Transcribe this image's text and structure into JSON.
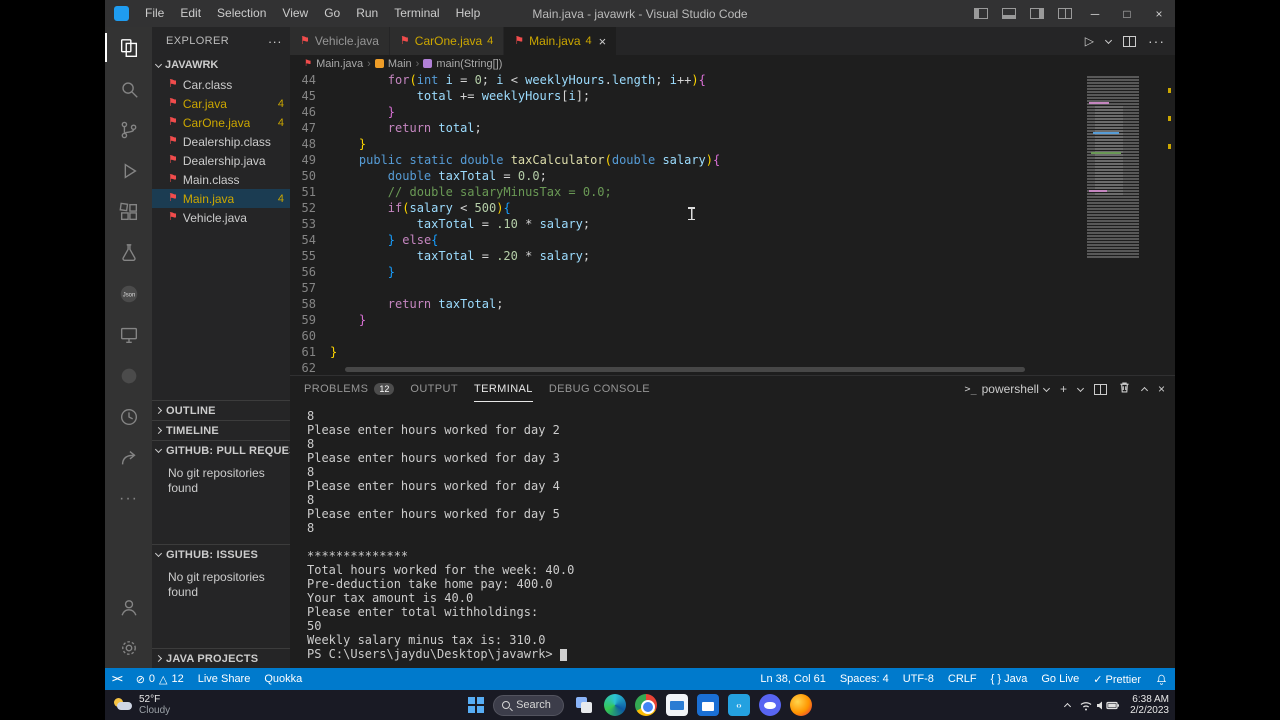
{
  "glyphs": {
    "file": "⚑",
    "close": "×",
    "more": "···",
    "run": "▷",
    "plus": "+",
    "error": "⊘",
    "warning": "△"
  },
  "title_bar": {
    "menus": [
      "File",
      "Edit",
      "Selection",
      "View",
      "Go",
      "Run",
      "Terminal",
      "Help"
    ],
    "title": "Main.java - javawrk - Visual Studio Code",
    "controls": [
      "─",
      "□",
      "×"
    ]
  },
  "activity_bar": {
    "items": [
      "explorer",
      "search",
      "source-control",
      "run-debug",
      "extensions",
      "testing",
      "json",
      "remote-explorer",
      "extension-circle",
      "clock",
      "live-share",
      "more",
      "account",
      "settings"
    ],
    "json_label": "Json",
    "more_label": "···"
  },
  "sidebar": {
    "header": "EXPLORER",
    "header_more": "···",
    "root_label": "JAVAWRK",
    "files": [
      {
        "label": "Car.class",
        "badge": ""
      },
      {
        "label": "Car.java",
        "badge": "4"
      },
      {
        "label": "CarOne.java",
        "badge": "4"
      },
      {
        "label": "Dealership.class",
        "badge": ""
      },
      {
        "label": "Dealership.java",
        "badge": ""
      },
      {
        "label": "Main.class",
        "badge": ""
      },
      {
        "label": "Main.java",
        "badge": "4",
        "selected": true
      },
      {
        "label": "Vehicle.java",
        "badge": ""
      }
    ],
    "sections": [
      {
        "label": "OUTLINE",
        "expanded": false,
        "body": ""
      },
      {
        "label": "TIMELINE",
        "expanded": false,
        "body": ""
      },
      {
        "label": "GITHUB: PULL REQUESTS",
        "expanded": true,
        "body": "No git repositories found"
      },
      {
        "label": "GITHUB: ISSUES",
        "expanded": true,
        "body": "No git repositories found"
      },
      {
        "label": "JAVA PROJECTS",
        "expanded": false,
        "body": ""
      }
    ]
  },
  "editor": {
    "tabs": [
      {
        "label": "Vehicle.java",
        "badge": "",
        "active": false
      },
      {
        "label": "CarOne.java",
        "badge": "4",
        "active": false
      },
      {
        "label": "Main.java",
        "badge": "4",
        "active": true
      }
    ],
    "breadcrumb": [
      {
        "label": "Main.java",
        "icon": "java-file"
      },
      {
        "label": "Main",
        "icon": "class"
      },
      {
        "label": "main(String[])",
        "icon": "method"
      }
    ],
    "lines": [
      {
        "n": "44",
        "tokens": [
          [
            "t",
            "        "
          ],
          [
            "p",
            "for"
          ],
          [
            "y",
            "("
          ],
          [
            "b",
            "int"
          ],
          [
            "t",
            " "
          ],
          [
            "v",
            "i"
          ],
          [
            "t",
            " = "
          ],
          [
            "n",
            "0"
          ],
          [
            "t",
            "; "
          ],
          [
            "v",
            "i"
          ],
          [
            "t",
            " < "
          ],
          [
            "v",
            "weeklyHours"
          ],
          [
            "t",
            "."
          ],
          [
            "v",
            "length"
          ],
          [
            "t",
            "; "
          ],
          [
            "v",
            "i"
          ],
          [
            "t",
            "++"
          ],
          [
            "y",
            ")"
          ],
          [
            "m",
            "{"
          ]
        ]
      },
      {
        "n": "45",
        "tokens": [
          [
            "t",
            "            "
          ],
          [
            "v",
            "total"
          ],
          [
            "t",
            " += "
          ],
          [
            "v",
            "weeklyHours"
          ],
          [
            "t",
            "["
          ],
          [
            "v",
            "i"
          ],
          [
            "t",
            "];"
          ]
        ]
      },
      {
        "n": "46",
        "tokens": [
          [
            "t",
            "        "
          ],
          [
            "m",
            "}"
          ]
        ]
      },
      {
        "n": "47",
        "tokens": [
          [
            "t",
            "        "
          ],
          [
            "p",
            "return"
          ],
          [
            "t",
            " "
          ],
          [
            "v",
            "total"
          ],
          [
            "t",
            ";"
          ]
        ]
      },
      {
        "n": "48",
        "tokens": [
          [
            "t",
            "    "
          ],
          [
            "y",
            "}"
          ]
        ]
      },
      {
        "n": "49",
        "tokens": [
          [
            "t",
            "    "
          ],
          [
            "b",
            "public"
          ],
          [
            "t",
            " "
          ],
          [
            "b",
            "static"
          ],
          [
            "t",
            " "
          ],
          [
            "b",
            "double"
          ],
          [
            "t",
            " "
          ],
          [
            "f",
            "taxCalculator"
          ],
          [
            "y",
            "("
          ],
          [
            "b",
            "double"
          ],
          [
            "t",
            " "
          ],
          [
            "v",
            "salary"
          ],
          [
            "y",
            ")"
          ],
          [
            "m",
            "{"
          ]
        ]
      },
      {
        "n": "50",
        "tokens": [
          [
            "t",
            "        "
          ],
          [
            "b",
            "double"
          ],
          [
            "t",
            " "
          ],
          [
            "v",
            "taxTotal"
          ],
          [
            "t",
            " = "
          ],
          [
            "n",
            "0.0"
          ],
          [
            "t",
            ";"
          ]
        ]
      },
      {
        "n": "51",
        "tokens": [
          [
            "t",
            "        "
          ],
          [
            "c",
            "// double salaryMinusTax = 0.0;"
          ]
        ]
      },
      {
        "n": "52",
        "tokens": [
          [
            "t",
            "        "
          ],
          [
            "p",
            "if"
          ],
          [
            "y",
            "("
          ],
          [
            "v",
            "salary"
          ],
          [
            "t",
            " < "
          ],
          [
            "n",
            "500"
          ],
          [
            "y",
            ")"
          ],
          [
            "u",
            "{"
          ]
        ]
      },
      {
        "n": "53",
        "tokens": [
          [
            "t",
            "            "
          ],
          [
            "v",
            "taxTotal"
          ],
          [
            "t",
            " = "
          ],
          [
            "n",
            ".10"
          ],
          [
            "t",
            " * "
          ],
          [
            "v",
            "salary"
          ],
          [
            "t",
            ";"
          ]
        ]
      },
      {
        "n": "54",
        "tokens": [
          [
            "t",
            "        "
          ],
          [
            "u",
            "}"
          ],
          [
            "t",
            " "
          ],
          [
            "p",
            "else"
          ],
          [
            "u",
            "{"
          ]
        ]
      },
      {
        "n": "55",
        "tokens": [
          [
            "t",
            "            "
          ],
          [
            "v",
            "taxTotal"
          ],
          [
            "t",
            " = "
          ],
          [
            "n",
            ".20"
          ],
          [
            "t",
            " * "
          ],
          [
            "v",
            "salary"
          ],
          [
            "t",
            ";"
          ]
        ]
      },
      {
        "n": "56",
        "tokens": [
          [
            "t",
            "        "
          ],
          [
            "u",
            "}"
          ]
        ]
      },
      {
        "n": "57",
        "tokens": []
      },
      {
        "n": "58",
        "tokens": [
          [
            "t",
            "        "
          ],
          [
            "p",
            "return"
          ],
          [
            "t",
            " "
          ],
          [
            "v",
            "taxTotal"
          ],
          [
            "t",
            ";"
          ]
        ]
      },
      {
        "n": "59",
        "tokens": [
          [
            "t",
            "    "
          ],
          [
            "m",
            "}"
          ]
        ]
      },
      {
        "n": "60",
        "tokens": []
      },
      {
        "n": "61",
        "tokens": [
          [
            "y",
            "}"
          ]
        ]
      },
      {
        "n": "62",
        "tokens": []
      }
    ]
  },
  "panel": {
    "tabs": [
      {
        "label": "PROBLEMS",
        "badge": "12",
        "active": false
      },
      {
        "label": "OUTPUT",
        "badge": "",
        "active": false
      },
      {
        "label": "TERMINAL",
        "badge": "",
        "active": true
      },
      {
        "label": "DEBUG CONSOLE",
        "badge": "",
        "active": false
      }
    ],
    "shell_icon": ">_",
    "shell_label": "powershell",
    "terminal_lines": [
      "8",
      "Please enter hours worked for day 2",
      "8",
      "Please enter hours worked for day 3",
      "8",
      "Please enter hours worked for day 4",
      "8",
      "Please enter hours worked for day 5",
      "8",
      "",
      "**************",
      "Total hours worked for the week: 40.0",
      "Pre-deduction take home pay: 400.0",
      "Your tax amount is 40.0",
      "Please enter total withholdings:",
      "50",
      "Weekly salary minus tax is: 310.0"
    ],
    "prompt": "PS C:\\Users\\jaydu\\Desktop\\javawrk>"
  },
  "status_bar": {
    "left": {
      "errors": "0",
      "warnings": "12",
      "live_share": "Live Share",
      "quokka": "Quokka"
    },
    "right": [
      "Ln 38, Col 61",
      "Spaces: 4",
      "UTF-8",
      "CRLF",
      "{ } Java",
      "Go Live",
      "✓ Prettier"
    ]
  },
  "taskbar": {
    "weather_temp": "52°F",
    "weather_desc": "Cloudy",
    "search": "Search",
    "apps": [
      "task-view",
      "edge",
      "chrome",
      "mail",
      "store",
      "vscode",
      "discord",
      "firefox"
    ],
    "vscode_glyph": "‹›",
    "time": "6:38 AM",
    "date": "2/2/2023"
  }
}
